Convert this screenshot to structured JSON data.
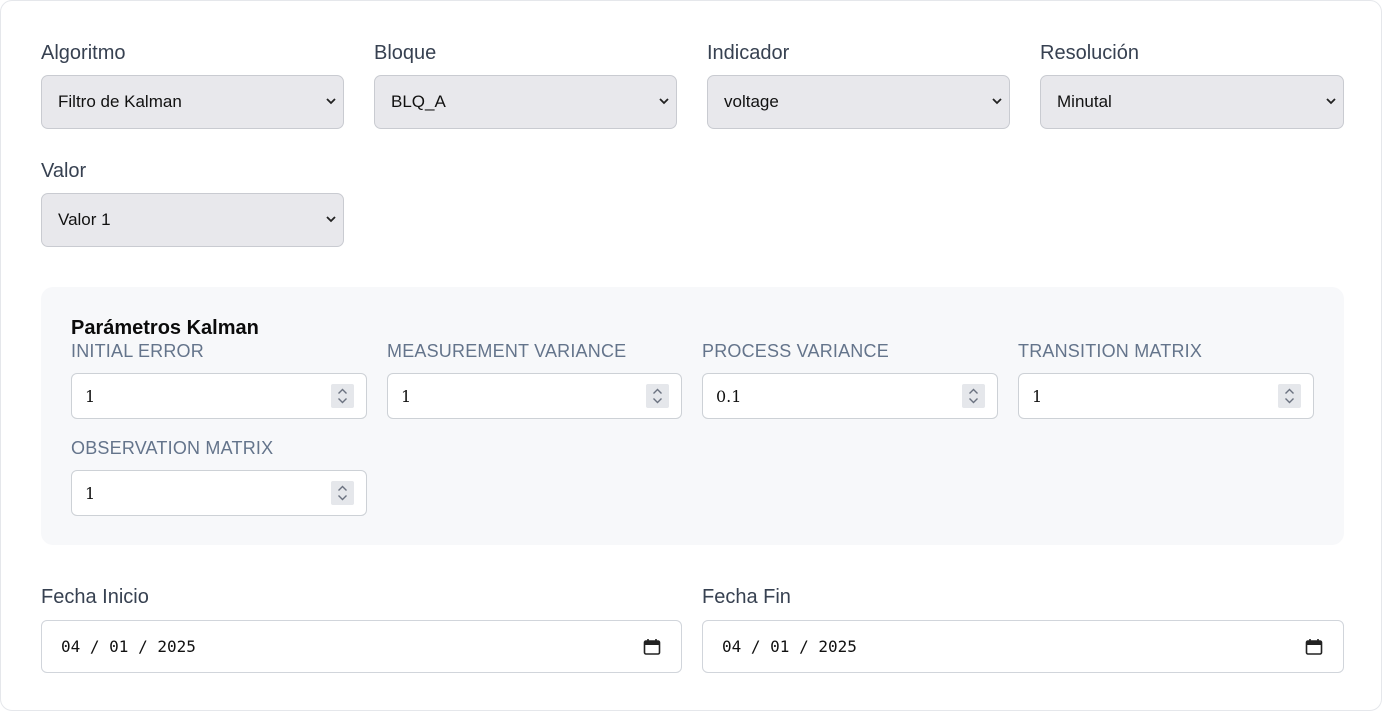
{
  "filters": {
    "algoritmo": {
      "label": "Algoritmo",
      "value": "Filtro de Kalman"
    },
    "bloque": {
      "label": "Bloque",
      "value": "BLQ_A"
    },
    "indicador": {
      "label": "Indicador",
      "value": "voltage"
    },
    "resolucion": {
      "label": "Resolución",
      "value": "Minutal"
    },
    "valor": {
      "label": "Valor",
      "value": "Valor 1"
    }
  },
  "kalman": {
    "title": "Parámetros Kalman",
    "params": [
      {
        "label": "INITIAL ERROR",
        "value": "1"
      },
      {
        "label": "MEASUREMENT VARIANCE",
        "value": "1"
      },
      {
        "label": "PROCESS VARIANCE",
        "value": "0.1"
      },
      {
        "label": "TRANSITION MATRIX",
        "value": "1"
      },
      {
        "label": "OBSERVATION MATRIX",
        "value": "1"
      }
    ]
  },
  "dates": {
    "inicio": {
      "label": "Fecha Inicio",
      "value": "04 / 01 / 2025"
    },
    "fin": {
      "label": "Fecha Fin",
      "value": "04 / 01 / 2025"
    }
  },
  "icons": {
    "select_chevron": "chevron-down-icon",
    "spinner": "spinner-arrows-icon",
    "calendar": "calendar-icon"
  }
}
